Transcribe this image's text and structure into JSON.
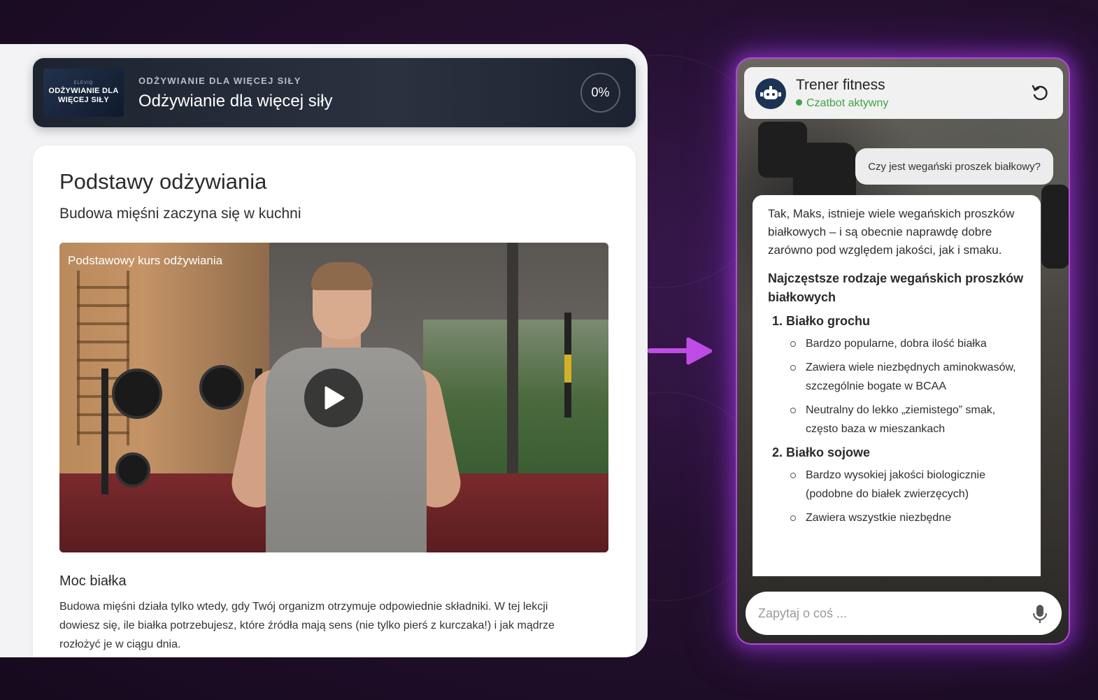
{
  "course": {
    "thumb_small": "ELEVIQ",
    "thumb_text": "ODŻYWIANIE DLA WIĘCEJ SIŁY",
    "overline": "ODŻYWIANIE DLA WIĘCEJ SIŁY",
    "title": "Odżywianie dla więcej siły",
    "progress": "0%"
  },
  "lesson": {
    "title": "Podstawy odżywiania",
    "subtitle": "Budowa mięśni zaczyna się w kuchni",
    "video_caption": "Podstawowy kurs odżywiania",
    "section_title": "Moc białka",
    "section_body": "Budowa mięśni działa tylko wtedy, gdy Twój organizm otrzymuje odpowiednie składniki. W tej lekcji dowiesz się, ile białka potrzebujesz, które źródła mają sens (nie tylko pierś z kurczaka!) i jak mądrze rozłożyć je w ciągu dnia."
  },
  "chat": {
    "bot_name": "Trener fitness",
    "status": "Czatbot aktywny",
    "user_message": "Czy jest wegański proszek białkowy?",
    "bot_intro": "Tak, Maks, istnieje wiele wegańskich proszków białkowych – i są obecnie naprawdę dobre zarówno pod względem jakości, jak i smaku.",
    "bot_heading": "Najczęstsze rodzaje wegańskich proszków białkowych",
    "items": [
      {
        "title": "1. Białko grochu",
        "bullets": [
          "Bardzo popularne, dobra ilość białka",
          "Zawiera wiele niezbędnych aminokwasów, szczególnie bogate w BCAA",
          "Neutralny do lekko „ziemistego” smak, często baza w mieszankach"
        ]
      },
      {
        "title": "2. Białko sojowe",
        "bullets": [
          "Bardzo wysokiej jakości biologicznie (podobne do białek zwierzęcych)",
          "Zawiera wszystkie niezbędne"
        ]
      }
    ],
    "input_placeholder": "Zapytaj o coś ..."
  },
  "colors": {
    "accent": "#b24ad8",
    "status_green": "#3fa24a",
    "background": "#24102f"
  }
}
